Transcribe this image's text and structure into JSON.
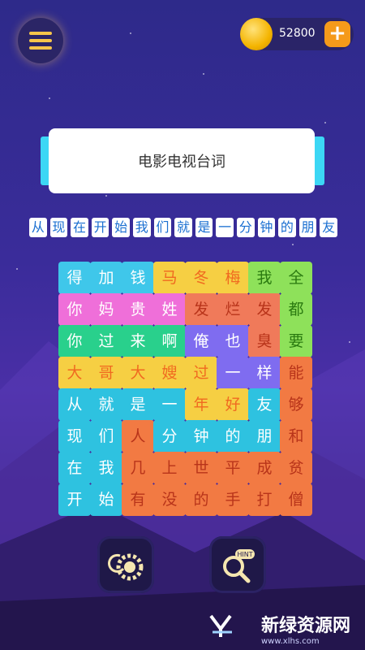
{
  "header": {
    "coins": "52800",
    "plus_label": "+"
  },
  "category": "电影电视台词",
  "phrase": [
    "从",
    "现",
    "在",
    "开",
    "始",
    "我",
    "们",
    "就",
    "是",
    "一",
    "分",
    "钟",
    "的",
    "朋",
    "友"
  ],
  "grid_rows": [
    [
      "得",
      "加",
      "钱",
      "马",
      "冬",
      "梅",
      "我",
      "全"
    ],
    [
      "你",
      "妈",
      "贵",
      "姓",
      "发",
      "烂",
      "发",
      "都"
    ],
    [
      "你",
      "过",
      "来",
      "啊",
      "俺",
      "也",
      "臭",
      "要"
    ],
    [
      "大",
      "哥",
      "大",
      "嫂",
      "过",
      "一",
      "样",
      "能"
    ],
    [
      "从",
      "就",
      "是",
      "一",
      "年",
      "好",
      "友",
      "够"
    ],
    [
      "现",
      "们",
      "人",
      "分",
      "钟",
      "的",
      "朋",
      "和"
    ],
    [
      "在",
      "我",
      "几",
      "上",
      "世",
      "平",
      "成",
      "贫"
    ],
    [
      "开",
      "始",
      "有",
      "没",
      "的",
      "手",
      "打",
      "僧"
    ]
  ],
  "word_colors": {
    "blue": "#3fc7ea",
    "yellow": "#f6cf43",
    "green": "#8ee15a",
    "pink": "#ef6fd9",
    "red": "#f07a5a",
    "mint": "#29d08c",
    "purple": "#7f6cf0",
    "peach": "#f6cf43",
    "cyan": "#2ec2e0",
    "orange": "#f27a43"
  },
  "watermark": {
    "title": "新绿资源网",
    "url": "www.xlhs.com"
  },
  "icons": [
    "menu-icon",
    "coin-icon",
    "plus-icon",
    "gear-bulb-icon",
    "hint-magnifier-icon"
  ]
}
